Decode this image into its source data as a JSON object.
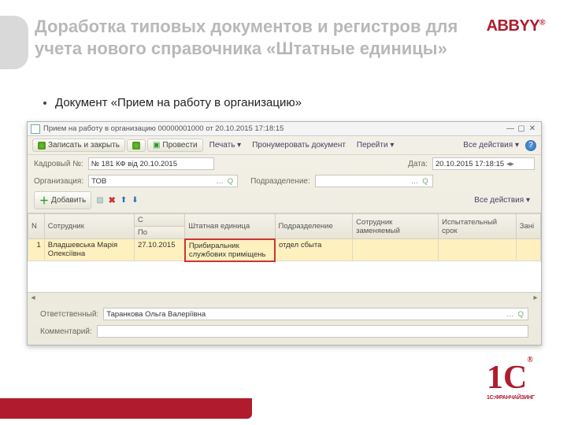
{
  "brand": {
    "abbyy": "ABBYY",
    "onec_label": "1С:ФРАНЧАЙЗИНГ"
  },
  "slide": {
    "title": "Доработка типовых документов и регистров для учета нового справочника «Штатные единицы»",
    "bullet1": "Документ «Прием на работу в организацию»"
  },
  "window": {
    "title": "Прием на работу в организацию 00000001000 от 20.10.2015 17:18:15",
    "toolbar": {
      "save_close": "Записать и закрыть",
      "post": "Провести",
      "print": "Печать",
      "renumber": "Пронумеровать документ",
      "goto": "Перейти",
      "all_actions": "Все действия"
    },
    "form": {
      "label_num": "Кадровый №:",
      "num_value": "№ 181 КФ від 20.10.2015",
      "label_date": "Дата:",
      "date_value": "20.10.2015 17:18:15",
      "label_org": "Организация:",
      "org_value": "ТОВ",
      "label_dept": "Подразделение:",
      "dept_value": ""
    },
    "addbar": {
      "add": "Добавить",
      "all_actions": "Все действия"
    },
    "columns": {
      "n": "N",
      "employee": "Сотрудник",
      "from": "С",
      "to": "По",
      "position": "Штатная единица",
      "dept": "Подразделение",
      "replaced": "Сотрудник заменяемый",
      "probation": "Испытательный срок",
      "overflow": "Зані"
    },
    "rows": [
      {
        "n": "1",
        "employee": "Владшевська Марія Олексіївна",
        "from": "27.10.2015",
        "position": "Прибиральник службових приміщень",
        "dept": "отдел сбыта"
      }
    ],
    "footer": {
      "label_resp": "Ответственный:",
      "resp_value": "Таранкова Ольга Валеріївна",
      "label_comment": "Комментарий:",
      "comment_value": ""
    }
  }
}
